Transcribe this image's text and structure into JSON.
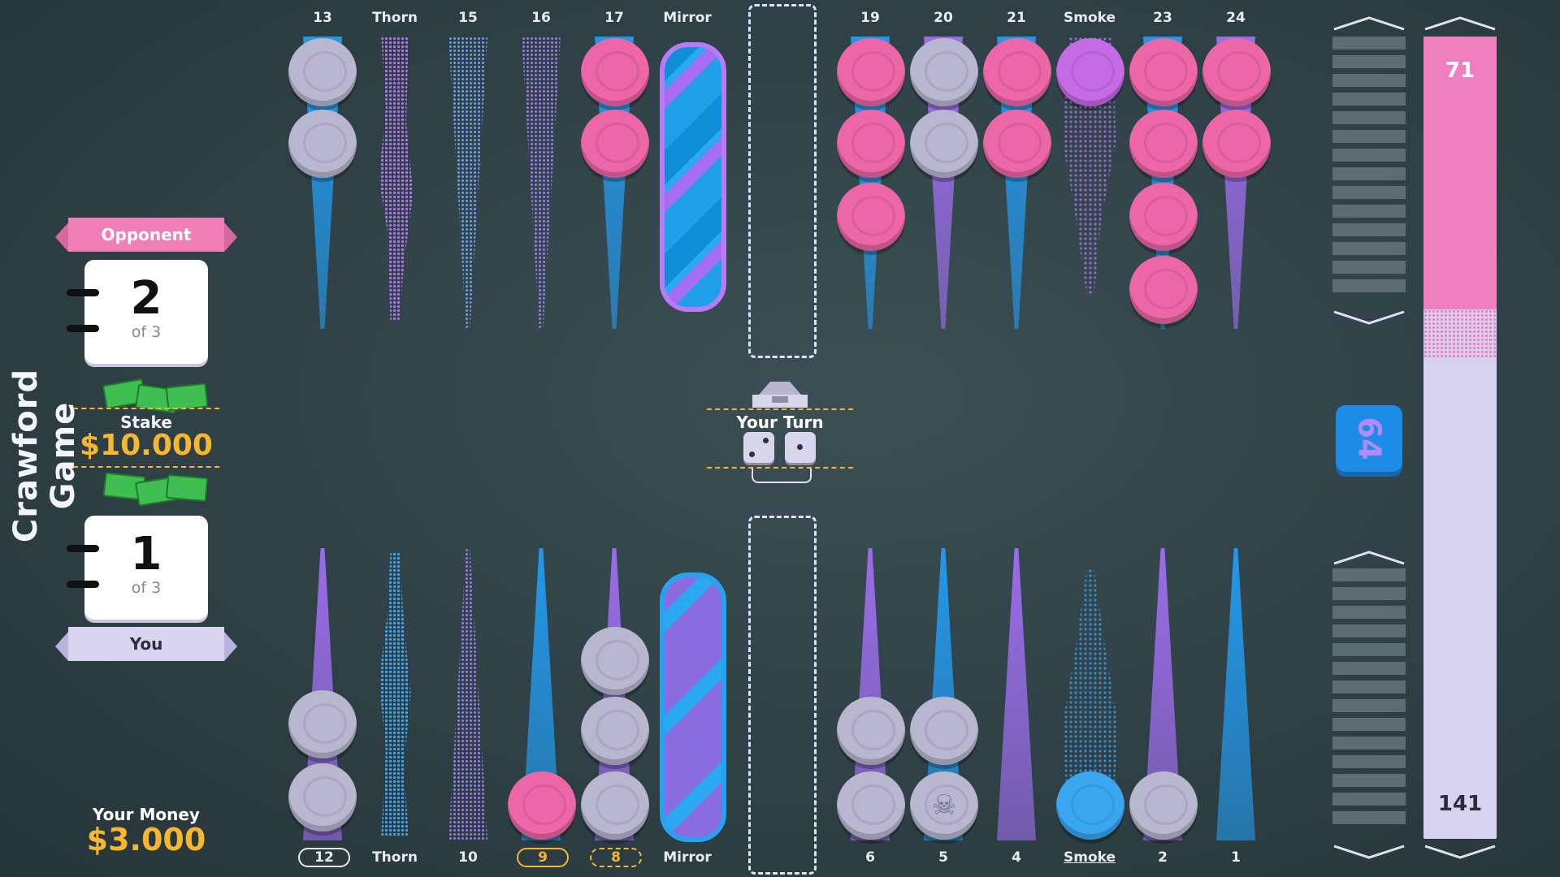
{
  "sidebar": {
    "game_mode": "Crawford Game",
    "opponent": {
      "label": "Opponent",
      "score": "2",
      "of": "of 3"
    },
    "player": {
      "label": "You",
      "score": "1",
      "of": "of 3"
    },
    "stake": {
      "label": "Stake",
      "value": "$10.000"
    },
    "money": {
      "label": "Your Money",
      "value": "$3.000"
    }
  },
  "board": {
    "top_labels": [
      "13",
      "Thorn",
      "15",
      "16",
      "17",
      "Mirror",
      "19",
      "20",
      "21",
      "Smoke",
      "23",
      "24"
    ],
    "bottom_labels": [
      "12",
      "Thorn",
      "10",
      "9",
      "8",
      "Mirror",
      "6",
      "5",
      "4",
      "Smoke",
      "2",
      "1"
    ]
  },
  "turn": {
    "label": "Your Turn",
    "dice": [
      2,
      1
    ]
  },
  "doubling_cube": {
    "value": "64"
  },
  "pip_count": {
    "opponent": "71",
    "player": "141"
  },
  "colors": {
    "opponent_checker": "#ec66a8",
    "player_checker": "#b9b6cf",
    "accent_gold": "#f5b630",
    "point_blue": "#239bf0",
    "point_purple": "#a06ef0"
  }
}
